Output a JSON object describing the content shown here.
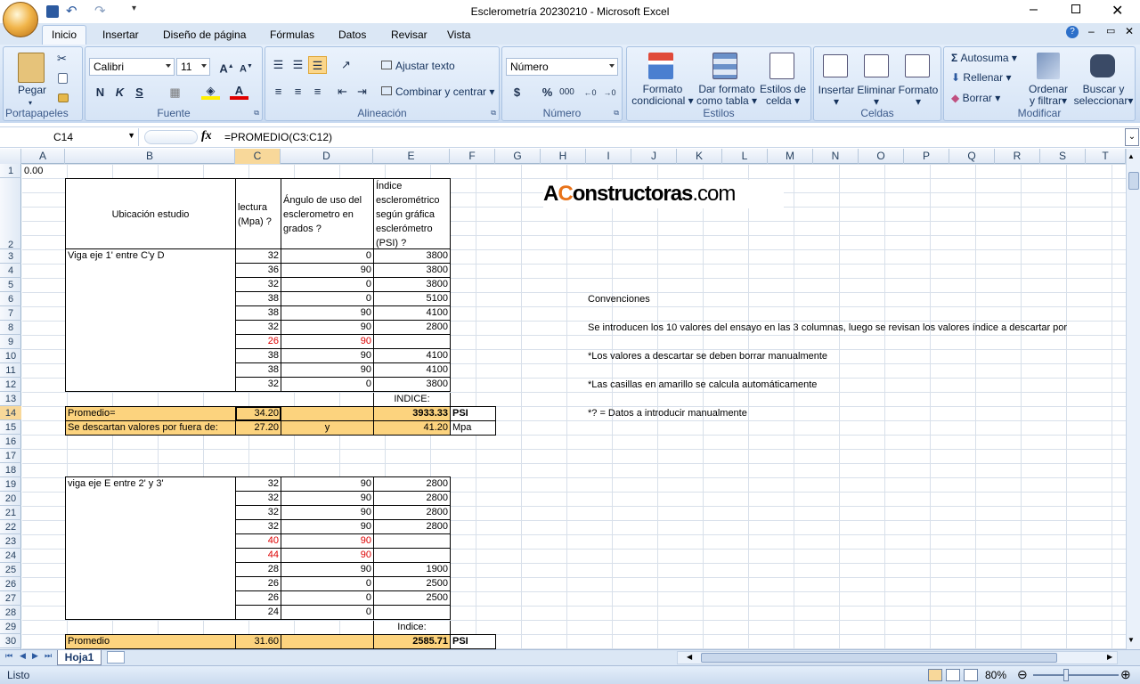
{
  "app": {
    "title": "Esclerometría 20230210 - Microsoft Excel"
  },
  "tabs": [
    "Inicio",
    "Insertar",
    "Diseño de página",
    "Fórmulas",
    "Datos",
    "Revisar",
    "Vista"
  ],
  "ribbon": {
    "clipboard": {
      "label": "Portapapeles",
      "paste": "Pegar"
    },
    "font": {
      "label": "Fuente",
      "name": "Calibri",
      "size": "11"
    },
    "alignment": {
      "label": "Alineación",
      "wrap": "Ajustar texto",
      "merge": "Combinar y centrar"
    },
    "number": {
      "label": "Número",
      "format": "Número"
    },
    "styles": {
      "label": "Estilos",
      "cond": [
        "Formato",
        "condicional"
      ],
      "table": [
        "Dar formato",
        "como tabla"
      ],
      "cell": [
        "Estilos de",
        "celda"
      ]
    },
    "cells": {
      "label": "Celdas",
      "insert": "Insertar",
      "delete": "Eliminar",
      "format": "Formato"
    },
    "editing": {
      "label": "Modificar",
      "autosum": "Autosuma",
      "fill": "Rellenar",
      "clear": "Borrar",
      "sort": [
        "Ordenar",
        "y filtrar"
      ],
      "find": [
        "Buscar y",
        "seleccionar"
      ]
    }
  },
  "formula_bar": {
    "name_box": "C14",
    "formula": "=PROMEDIO(C3:C12)"
  },
  "columns": [
    "A",
    "B",
    "C",
    "D",
    "E",
    "F",
    "G",
    "H",
    "I",
    "J",
    "K",
    "L",
    "M",
    "N",
    "O",
    "P",
    "Q",
    "R",
    "S",
    "T"
  ],
  "rows": [
    "1",
    "2",
    "3",
    "4",
    "5",
    "6",
    "7",
    "8",
    "9",
    "10",
    "11",
    "12",
    "13",
    "14",
    "15",
    "16",
    "17",
    "18",
    "19",
    "20",
    "21",
    "22",
    "23",
    "24",
    "25",
    "26",
    "27",
    "28",
    "29",
    "30"
  ],
  "sheet": {
    "a1": "0.00",
    "hdr_b": "Ubicación estudio",
    "hdr_c": [
      "lectura",
      "(Mpa) ?"
    ],
    "hdr_d": [
      "Ángulo de uso del",
      "esclerometro en",
      "grados ?"
    ],
    "hdr_e": [
      "Índice",
      "esclerométrico",
      "según gráfica",
      "esclerómetro",
      "(PSI) ?"
    ],
    "logo": "AConstructoras.com",
    "block1": {
      "label": "Viga eje 1'  entre C'y D",
      "rows": [
        [
          "32",
          "0",
          "3800"
        ],
        [
          "36",
          "90",
          "3800"
        ],
        [
          "32",
          "0",
          "3800"
        ],
        [
          "38",
          "0",
          "5100"
        ],
        [
          "38",
          "90",
          "4100"
        ],
        [
          "32",
          "90",
          "2800"
        ],
        [
          "26",
          "90",
          ""
        ],
        [
          "38",
          "90",
          "4100"
        ],
        [
          "38",
          "90",
          "4100"
        ],
        [
          "32",
          "0",
          "3800"
        ]
      ],
      "indice": "INDICE:",
      "prom_label": "Promedio=",
      "prom_c": "34.20",
      "prom_e": "3933.33",
      "psi": "PSI",
      "desc_label": "Se descartan valores por fuera de:",
      "desc_c": "27.20",
      "desc_d": "y",
      "desc_e": "41.20",
      "mpa": "Mpa"
    },
    "block2": {
      "label": "viga eje E entre 2' y 3'",
      "rows": [
        [
          "32",
          "90",
          "2800"
        ],
        [
          "32",
          "90",
          "2800"
        ],
        [
          "32",
          "90",
          "2800"
        ],
        [
          "32",
          "90",
          "2800"
        ],
        [
          "40",
          "90",
          ""
        ],
        [
          "44",
          "90",
          ""
        ],
        [
          "28",
          "90",
          "1900"
        ],
        [
          "26",
          "0",
          "2500"
        ],
        [
          "26",
          "0",
          "2500"
        ],
        [
          "24",
          "0",
          ""
        ]
      ],
      "indice": "Indice:",
      "prom_label": "Promedio",
      "prom_c": "31.60",
      "prom_e": "2585.71",
      "psi": "PSI"
    },
    "notes": [
      "Convenciones",
      "Se introducen los 10 valores del ensayo en las 3 columnas,  luego se revisan los valores índice a descartar por",
      "*Los valores a descartar se deben borrar manualmente",
      "*Las casillas en amarillo se calcula automáticamente",
      "*? = Datos a introducir manualmente"
    ]
  },
  "sheet_tab": "Hoja1",
  "status": {
    "ready": "Listo",
    "zoom": "80%"
  }
}
